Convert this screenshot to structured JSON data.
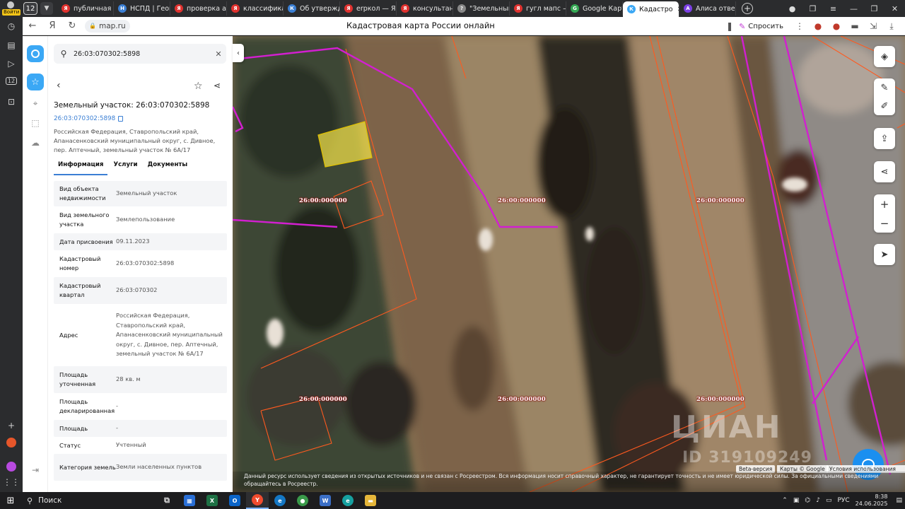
{
  "browser": {
    "login_badge": "Войти",
    "tab_count": "12",
    "tabs": [
      {
        "label": "публичная к",
        "color": "#e0322f",
        "glyph": "Я"
      },
      {
        "label": "НСПД | Геоп",
        "color": "#3b7fd4",
        "glyph": "Н"
      },
      {
        "label": "проверка ав",
        "color": "#e0322f",
        "glyph": "Я"
      },
      {
        "label": "классифика",
        "color": "#e0322f",
        "glyph": "Я"
      },
      {
        "label": "Об утвержд",
        "color": "#3b7fd4",
        "glyph": "К"
      },
      {
        "label": "erpкол — Ян",
        "color": "#e0322f",
        "glyph": "Я"
      },
      {
        "label": "консультант",
        "color": "#e0322f",
        "glyph": "Я"
      },
      {
        "label": "\"Земельный",
        "color": "#888888",
        "glyph": "?"
      },
      {
        "label": "гугл мапс —",
        "color": "#e0322f",
        "glyph": "Я"
      },
      {
        "label": "Google Карт",
        "color": "#34a853",
        "glyph": "G"
      },
      {
        "label": "Кадастро",
        "color": "#3ba8f5",
        "glyph": "К",
        "active": true
      },
      {
        "label": "Алиса отвеча",
        "color": "#7b3fe4",
        "glyph": "А"
      }
    ],
    "url": "map.ru",
    "page_title": "Кадастровая карта России онлайн",
    "ask_label": "Спросить"
  },
  "panel": {
    "search_value": "26:03:070302:5898",
    "title": "Земельный участок: 26:03:070302:5898",
    "cadastral_link": "26:03:070302:5898",
    "address_short": "Российская Федерация, Ставропольский край, Апанасенковский муниципальный округ, с. Дивное, пер. Аптечный, земельный участок № 6А/17",
    "tabs": [
      "Информация",
      "Услуги",
      "Документы"
    ],
    "rows": [
      {
        "k": "Вид объекта недвижимости",
        "v": "Земельный участок"
      },
      {
        "k": "Вид земельного участка",
        "v": "Землепользование"
      },
      {
        "k": "Дата присвоения",
        "v": "09.11.2023"
      },
      {
        "k": "Кадастровый номер",
        "v": "26:03:070302:5898"
      },
      {
        "k": "Кадастровый квартал",
        "v": "26:03:070302"
      },
      {
        "k": "Адрес",
        "v": "Российская Федерация, Ставропольский край, Апанасенковский муниципальный округ, с. Дивное, пер. Аптечный, земельный участок № 6А/17"
      },
      {
        "k": "Площадь уточненная",
        "v": "28 кв. м"
      },
      {
        "k": "Площадь декларированная",
        "v": "-"
      },
      {
        "k": "Площадь",
        "v": "-"
      },
      {
        "k": "Статус",
        "v": "Учтенный"
      },
      {
        "k": "Категория земель",
        "v": "Земли населенных пунктов"
      }
    ]
  },
  "map": {
    "parcel_labels": [
      "26:00:000000",
      "26:00:000000",
      "26:00:000000",
      "26:00:000000",
      "26:00:000000",
      "26:00:000000"
    ],
    "beta": "Beta-версия",
    "attribution": "Карты © Google",
    "terms": "Условия использования",
    "disclaimer": "Данный ресурс использует сведения из открытых источников и не связан с Росреестром. Вся информация носит справочный характер, не гарантирует точность и не имеет юридической силы. За официальными сведениями обращайтесь в Росреестр.",
    "watermark": "ЦИАН",
    "watermark_id": "ID 319109249"
  },
  "taskbar": {
    "search_label": "Поиск",
    "lang": "РУС",
    "time": "8:38",
    "date": "24.06.2025"
  },
  "colors": {
    "accent": "#3ba8f5",
    "link": "#3b7fd4",
    "boundary_magenta": "#d21fd0",
    "boundary_orange": "#ff5a1f",
    "selected_parcel": "#f2e24a"
  }
}
